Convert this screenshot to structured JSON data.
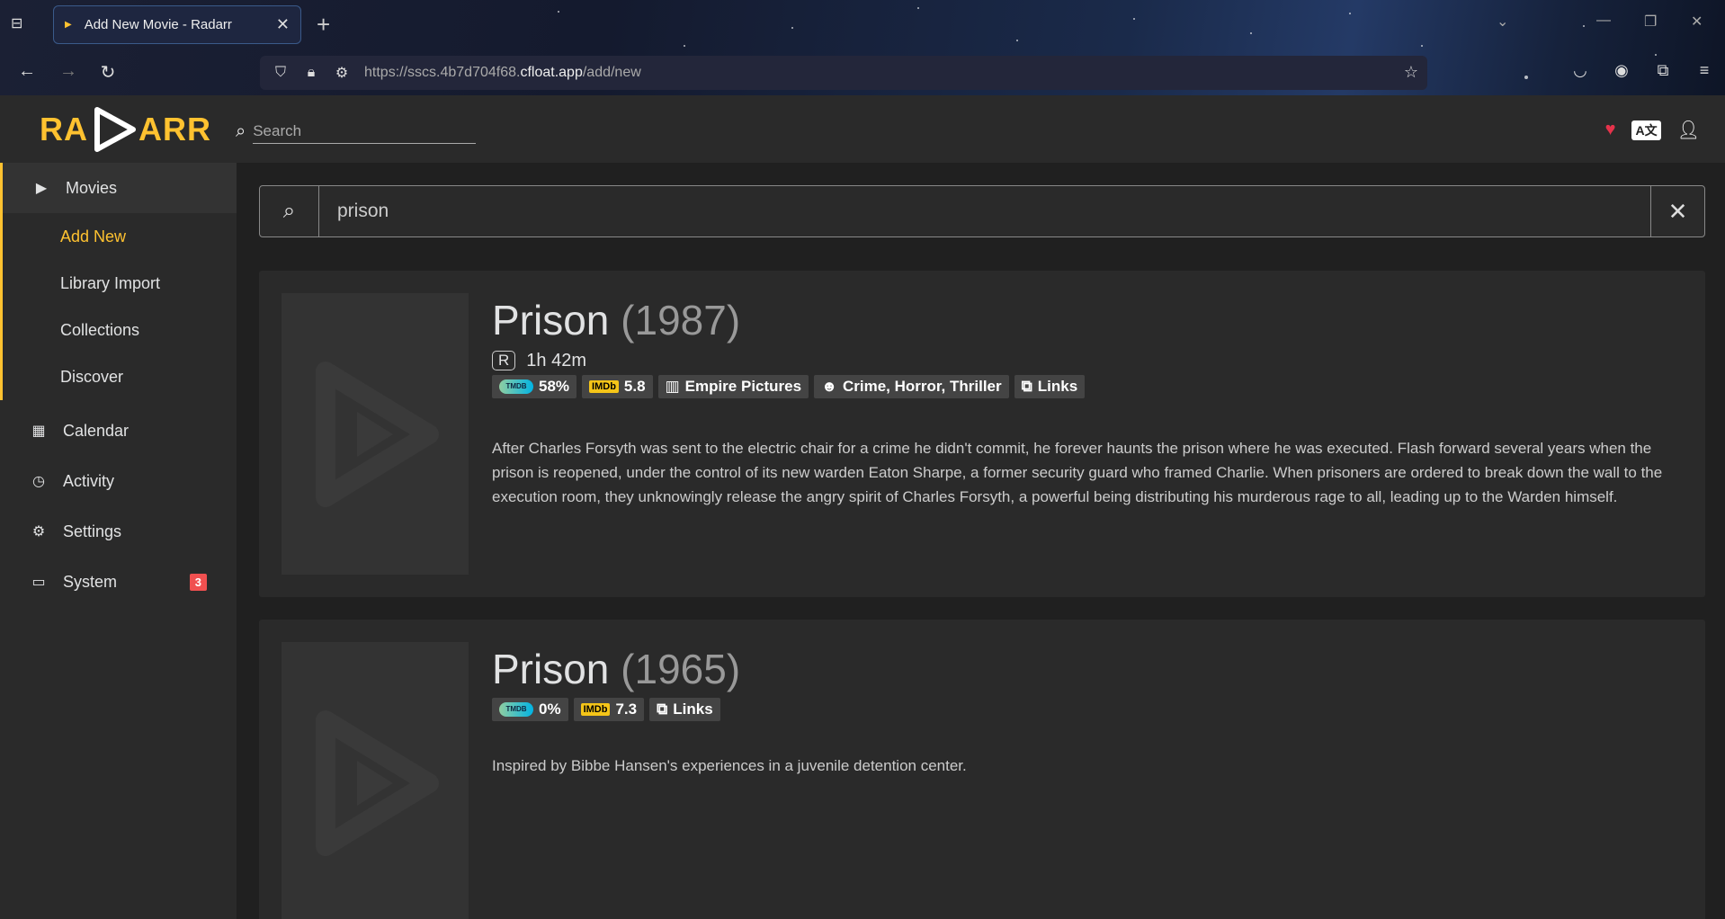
{
  "browser": {
    "tab_title": "Add New Movie - Radarr",
    "url_host": "https://sscs.4b7d704f68.",
    "url_domain": "cfloat.app",
    "url_path": "/add/new"
  },
  "header": {
    "logo_left": "RA",
    "logo_right": "ARR",
    "search_placeholder": "Search"
  },
  "sidebar": {
    "movies": "Movies",
    "sub": [
      "Add New",
      "Library Import",
      "Collections",
      "Discover"
    ],
    "calendar": "Calendar",
    "activity": "Activity",
    "settings": "Settings",
    "system": "System",
    "system_badge": "3"
  },
  "search": {
    "query": "prison"
  },
  "results": [
    {
      "title": "Prison",
      "year": "(1987)",
      "certification": "R",
      "runtime": "1h 42m",
      "tmdb_rating": "58%",
      "imdb_rating": "5.8",
      "studio": "Empire Pictures",
      "genres": "Crime, Horror, Thriller",
      "links": "Links",
      "overview": "After Charles Forsyth was sent to the electric chair for a crime he didn't commit, he forever haunts the prison where he was executed. Flash forward several years when the prison is reopened, under the control of its new warden Eaton Sharpe, a former security guard who framed Charlie. When prisoners are ordered to break down the wall to the execution room, they unknowingly release the angry spirit of Charles Forsyth, a powerful being distributing his murderous rage to all, leading up to the Warden himself."
    },
    {
      "title": "Prison",
      "year": "(1965)",
      "tmdb_rating": "0%",
      "imdb_rating": "7.3",
      "links": "Links",
      "overview": "Inspired by Bibbe Hansen's experiences in a juvenile detention center."
    }
  ],
  "colors": {
    "accent": "#ffc230",
    "badge": "#f05050",
    "heart": "#e5334b"
  },
  "icons": {
    "tab_favicon": "play-triangle-icon",
    "search": "search-icon",
    "clear": "close-icon",
    "movies": "play-icon",
    "calendar": "calendar-icon",
    "activity": "clock-icon",
    "settings": "gears-icon",
    "system": "laptop-icon"
  }
}
